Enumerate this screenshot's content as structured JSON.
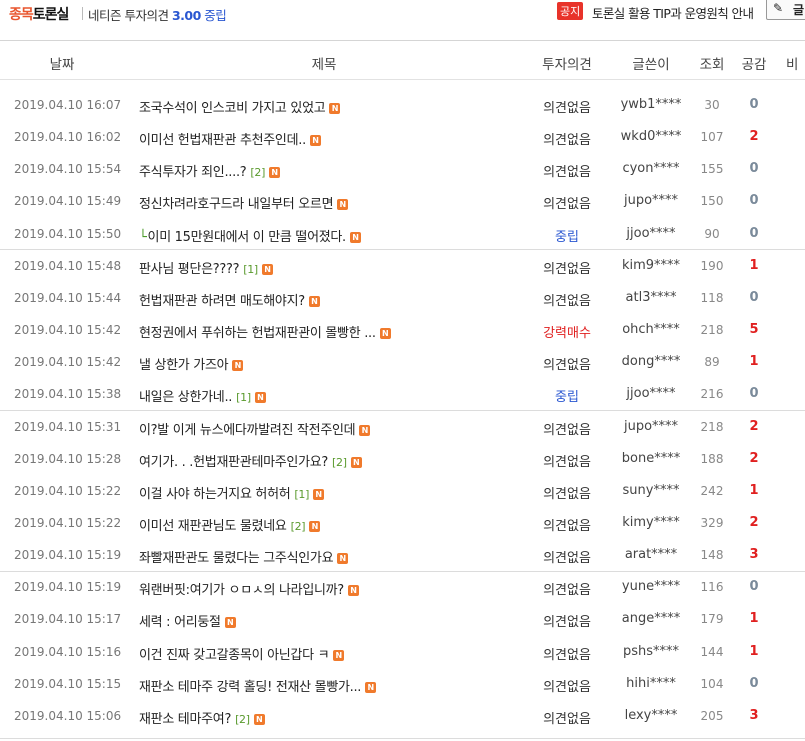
{
  "brand": {
    "part1": "종목",
    "part2": "토론실"
  },
  "opinion": {
    "prefix": "네티즌 투자의견 ",
    "score": "3.00",
    "label": " 중립"
  },
  "notice": {
    "badge": "공지",
    "text": "토론실 활용 TIP과 운영원칙 안내"
  },
  "write_button": {
    "label": "글"
  },
  "columns": {
    "date": "날짜",
    "title": "제목",
    "opinion": "투자의견",
    "writer": "글쓴이",
    "views": "조회",
    "likes": "공감",
    "dislikes": "비"
  },
  "new_badge": "N",
  "reply_arrow": "└",
  "posts": [
    {
      "date": "2019.04.10 16:07",
      "title": "조국수석이 인스코비 가지고 있었고",
      "count": "",
      "opinion": "의견없음",
      "op_type": "none",
      "writer": "ywb1****",
      "views": "30",
      "likes": "0",
      "reply": false
    },
    {
      "date": "2019.04.10 16:02",
      "title": "이미선 헌법재판관 추천주인데..",
      "count": "",
      "opinion": "의견없음",
      "op_type": "none",
      "writer": "wkd0****",
      "views": "107",
      "likes": "2",
      "reply": false
    },
    {
      "date": "2019.04.10 15:54",
      "title": "주식투자가 죄인....?",
      "count": "[2]",
      "opinion": "의견없음",
      "op_type": "none",
      "writer": "cyon****",
      "views": "155",
      "likes": "0",
      "reply": false
    },
    {
      "date": "2019.04.10 15:49",
      "title": "정신차려라호구드라 내일부터 오르면",
      "count": "",
      "opinion": "의견없음",
      "op_type": "none",
      "writer": "jupo****",
      "views": "150",
      "likes": "0",
      "reply": false
    },
    {
      "date": "2019.04.10 15:50",
      "title": "이미 15만원대에서 이 만큼 떨어졌다.",
      "count": "",
      "opinion": "중립",
      "op_type": "neu",
      "writer": "jjoo****",
      "views": "90",
      "likes": "0",
      "reply": true
    },
    {
      "date": "2019.04.10 15:48",
      "title": "판사님 평단은????",
      "count": "[1]",
      "opinion": "의견없음",
      "op_type": "none",
      "writer": "kim9****",
      "views": "190",
      "likes": "1",
      "reply": false
    },
    {
      "date": "2019.04.10 15:44",
      "title": "헌법재판관 하려면 매도해야지?",
      "count": "",
      "opinion": "의견없음",
      "op_type": "none",
      "writer": "atl3****",
      "views": "118",
      "likes": "0",
      "reply": false
    },
    {
      "date": "2019.04.10 15:42",
      "title": "현정권에서 푸쉬하는 헌법재판관이 몰빵한 ...",
      "count": "",
      "opinion": "강력매수",
      "op_type": "buy",
      "writer": "ohch****",
      "views": "218",
      "likes": "5",
      "reply": false
    },
    {
      "date": "2019.04.10 15:42",
      "title": "낼 상한가 가즈아",
      "count": "",
      "opinion": "의견없음",
      "op_type": "none",
      "writer": "dong****",
      "views": "89",
      "likes": "1",
      "reply": false
    },
    {
      "date": "2019.04.10 15:38",
      "title": "내일은 상한가네..",
      "count": "[1]",
      "opinion": "중립",
      "op_type": "neu",
      "writer": "jjoo****",
      "views": "216",
      "likes": "0",
      "reply": false
    },
    {
      "date": "2019.04.10 15:31",
      "title": "이?발 이게 뉴스에다까발려진 작전주인데",
      "count": "",
      "opinion": "의견없음",
      "op_type": "none",
      "writer": "jupo****",
      "views": "218",
      "likes": "2",
      "reply": false
    },
    {
      "date": "2019.04.10 15:28",
      "title": "여기가. . .헌법재판관테마주인가요?",
      "count": "[2]",
      "opinion": "의견없음",
      "op_type": "none",
      "writer": "bone****",
      "views": "188",
      "likes": "2",
      "reply": false
    },
    {
      "date": "2019.04.10 15:22",
      "title": "이걸 사야 하는거지요 허허허",
      "count": "[1]",
      "opinion": "의견없음",
      "op_type": "none",
      "writer": "suny****",
      "views": "242",
      "likes": "1",
      "reply": false
    },
    {
      "date": "2019.04.10 15:22",
      "title": "이미선 재판관님도 물렸네요",
      "count": "[2]",
      "opinion": "의견없음",
      "op_type": "none",
      "writer": "kimy****",
      "views": "329",
      "likes": "2",
      "reply": false
    },
    {
      "date": "2019.04.10 15:19",
      "title": "좌빨재판관도 물렸다는 그주식인가요",
      "count": "",
      "opinion": "의견없음",
      "op_type": "none",
      "writer": "arat****",
      "views": "148",
      "likes": "3",
      "reply": false
    },
    {
      "date": "2019.04.10 15:19",
      "title": "워랜버핏:여기가 ㅇㅁㅅ의 나라입니까?",
      "count": "",
      "opinion": "의견없음",
      "op_type": "none",
      "writer": "yune****",
      "views": "116",
      "likes": "0",
      "reply": false
    },
    {
      "date": "2019.04.10 15:17",
      "title": "세력 : 어리둥절",
      "count": "",
      "opinion": "의견없음",
      "op_type": "none",
      "writer": "ange****",
      "views": "179",
      "likes": "1",
      "reply": false
    },
    {
      "date": "2019.04.10 15:16",
      "title": "이건 진짜 갖고갈종목이 아닌갑다 ㅋ",
      "count": "",
      "opinion": "의견없음",
      "op_type": "none",
      "writer": "pshs****",
      "views": "144",
      "likes": "1",
      "reply": false
    },
    {
      "date": "2019.04.10 15:15",
      "title": "재판소 테마주 강력 홀딩! 전재산 몰빵가...",
      "count": "",
      "opinion": "의견없음",
      "op_type": "none",
      "writer": "hihi****",
      "views": "104",
      "likes": "0",
      "reply": false
    },
    {
      "date": "2019.04.10 15:06",
      "title": "재판소 테마주여?",
      "count": "[2]",
      "opinion": "의견없음",
      "op_type": "none",
      "writer": "lexy****",
      "views": "205",
      "likes": "3",
      "reply": false
    }
  ]
}
